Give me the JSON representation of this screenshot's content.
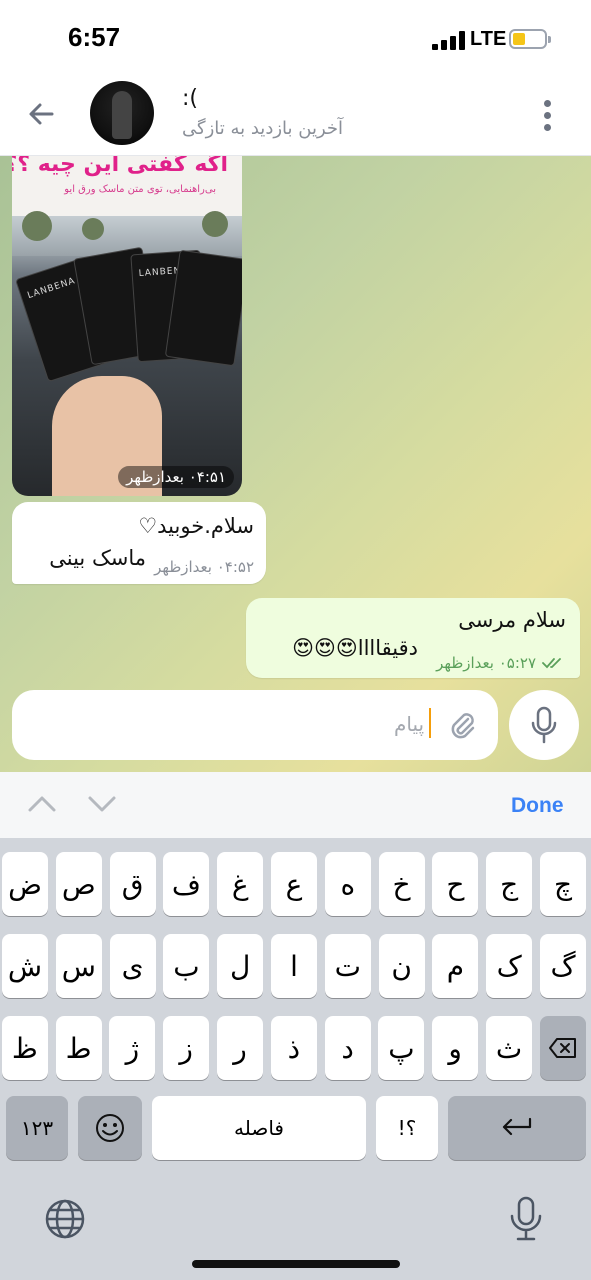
{
  "status_bar": {
    "time": "6:57",
    "network": "LTE"
  },
  "header": {
    "name": ":(",
    "status": "آخرین بازدید به تازگی",
    "back_icon": "arrow-left-icon",
    "more_icon": "more-vertical-icon"
  },
  "messages": {
    "photo": {
      "title": "اگه گفتی این چیه ؟؟",
      "subtitle": "بی‌راهنمایی، توی متن ماسک ورق ایو",
      "brand": "LANBENA",
      "time": "۰۴:۵۱ بعدازظهر"
    },
    "incoming": {
      "line1": "سلام.خوبید♡",
      "line2": "ماسک بینی",
      "time": "۰۴:۵۲ بعدازظهر"
    },
    "outgoing": {
      "line1": "سلام مرسی",
      "line2": "دقیقاااا😍😍😍",
      "time": "۰۵:۲۷ بعدازظهر"
    }
  },
  "input": {
    "placeholder": "پیام"
  },
  "keyboard": {
    "done": "Done",
    "row1": [
      "چ",
      "ج",
      "ح",
      "خ",
      "ه",
      "ع",
      "غ",
      "ف",
      "ق",
      "ص",
      "ض"
    ],
    "row2": [
      "گ",
      "ک",
      "م",
      "ن",
      "ت",
      "ا",
      "ل",
      "ب",
      "ی",
      "س",
      "ش"
    ],
    "row3": [
      "ث",
      "و",
      "پ",
      "د",
      "ذ",
      "ر",
      "ز",
      "ژ",
      "ط",
      "ظ"
    ],
    "numbers_key": "۱۲۳",
    "space": "فاصله",
    "punct_key": "!؟",
    "return_icon": "return-icon",
    "emoji_icon": "emoji-icon",
    "globe_icon": "globe-icon",
    "dictation_icon": "microphone-icon",
    "backspace_icon": "backspace-icon"
  },
  "colors": {
    "accent": "#3b82f6",
    "bubble_out": "#effdde",
    "check": "#5aa05a"
  }
}
